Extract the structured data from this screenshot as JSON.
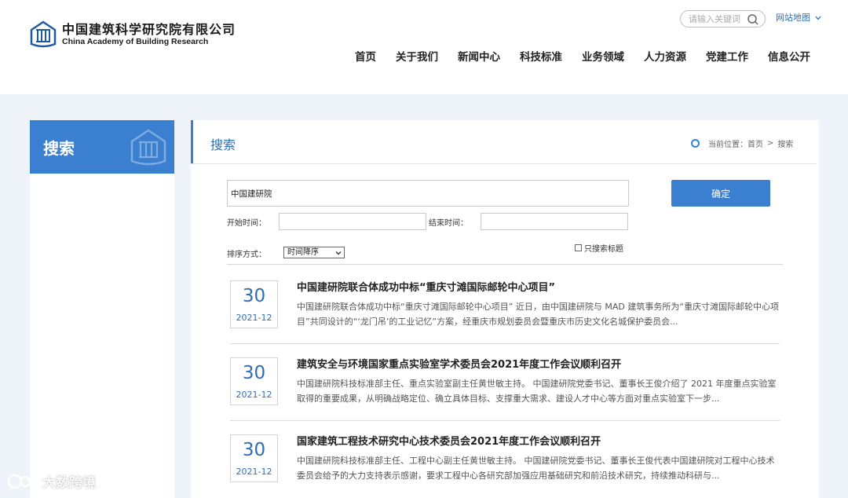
{
  "header": {
    "logo_cn": "中国建筑科学研究院有限公司",
    "logo_en": "China Academy of Building Research",
    "search_placeholder": "请输入关键词",
    "sitemap_label": "网站地图",
    "nav": [
      "首页",
      "关于我们",
      "新闻中心",
      "科技标准",
      "业务领域",
      "人力资源",
      "党建工作",
      "信息公开"
    ]
  },
  "sidebar": {
    "title": "搜索"
  },
  "main": {
    "title": "搜索",
    "breadcrumb": {
      "prefix": "当前位置：",
      "home": "首页",
      "separator": ">",
      "current": "搜索"
    },
    "search": {
      "keyword_value": "中国建研院",
      "confirm_label": "确定",
      "start_label": "开始时间：",
      "end_label": "结束时间：",
      "title_only_label": "只搜索标题",
      "sort_label": "排序方式：",
      "sort_value": "时间降序"
    },
    "results": [
      {
        "day": "30",
        "ym": "2021-12",
        "title": "中国建研院联合体成功中标“重庆寸滩国际邮轮中心项目”",
        "summary": "中国建研院联合体成功中标“重庆寸滩国际邮轮中心项目” 近日，由中国建研院与 MAD 建筑事务所为“重庆寸滩国际邮轮中心项目”共同设计的“‘龙门吊’的工业记忆”方案，经重庆市规划委员会暨重庆市历史文化名城保护委员会..."
      },
      {
        "day": "30",
        "ym": "2021-12",
        "title": "建筑安全与环境国家重点实验室学术委员会2021年度工作会议顺利召开",
        "summary": "中国建研院科技标准部主任、重点实验室副主任黄世敏主持。 中国建研院党委书记、董事长王俊介绍了 2021 年度重点实验室取得的重要成果，从明确战略定位、确立具体目标、支撑重大需求、建设人才中心等方面对重点实验室下一步..."
      },
      {
        "day": "30",
        "ym": "2021-12",
        "title": "国家建筑工程技术研究中心技术委员会2021年度工作会议顺利召开",
        "summary": "中国建研院科技标准部主任、工程中心副主任黄世敏主持。 中国建研院党委书记、董事长王俊代表中国建研院对工程中心技术委员会给予的大力支持表示感谢，要求工程中心各研究部加强应用基础研究和前沿技术研究，持续推动科研与..."
      }
    ]
  },
  "watermark": {
    "text": "大数跨境"
  },
  "colors": {
    "accent": "#3a7fd0",
    "link": "#2f6db5",
    "page_bg": "#eef4f9"
  }
}
